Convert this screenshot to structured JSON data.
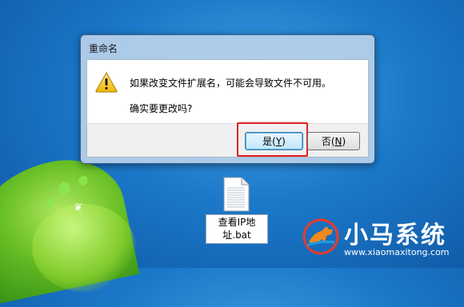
{
  "dialog": {
    "title": "重命名",
    "message_line1": "如果改变文件扩展名，可能会导致文件不可用。",
    "message_line2": "确实要更改吗?",
    "buttons": [
      {
        "label": "是",
        "accel": "Y"
      },
      {
        "label": "否",
        "accel": "N"
      }
    ]
  },
  "desktop": {
    "file": {
      "name_line1": "查看IP地",
      "name_line2": "址.bat"
    }
  },
  "watermark": {
    "logo_text": "小马系统",
    "url": "www.xiaomaxitong.com"
  },
  "colors": {
    "highlight": "#e02020",
    "desktop_bg": "#1b78c9"
  },
  "icons": [
    "warning-icon",
    "bat-file-icon",
    "horse-logo-icon"
  ]
}
